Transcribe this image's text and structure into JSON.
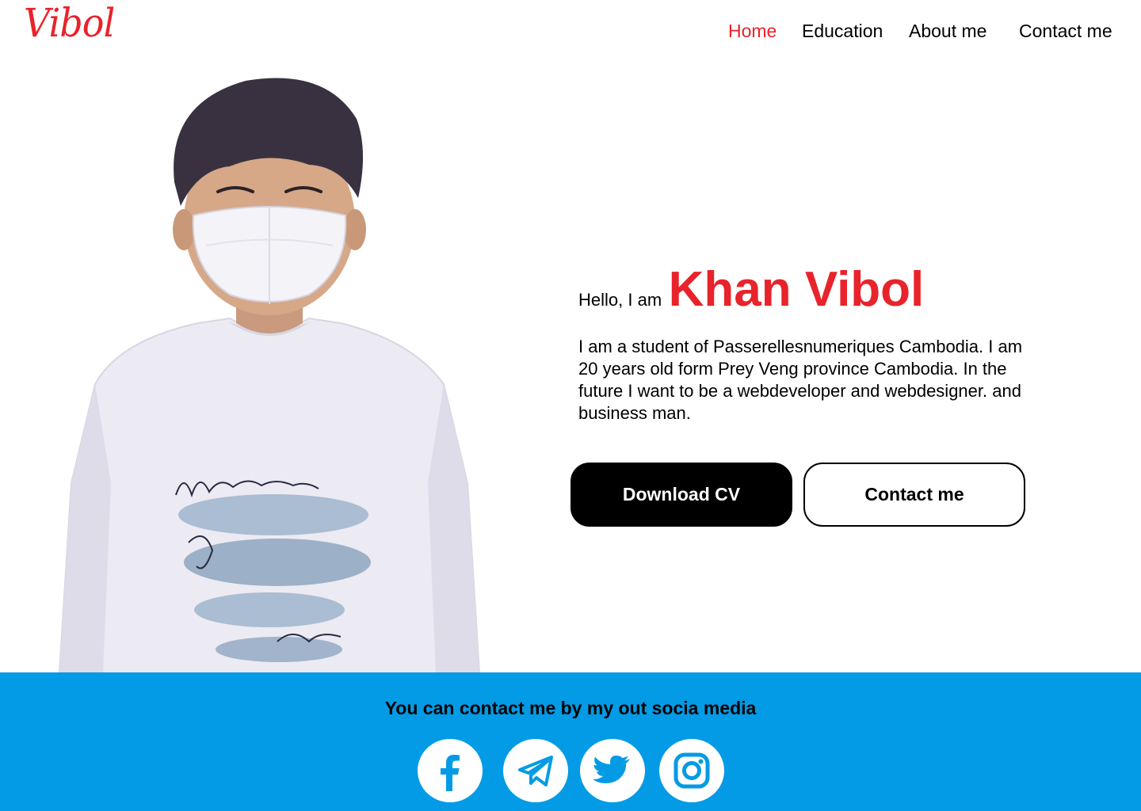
{
  "header": {
    "logo": "Vibol",
    "nav": [
      {
        "label": "Home",
        "active": true
      },
      {
        "label": "Education",
        "active": false
      },
      {
        "label": "About me",
        "active": false
      },
      {
        "label": "Contact me",
        "active": false
      }
    ]
  },
  "hero": {
    "greeting": "Hello, I am",
    "name": "Khan Vibol",
    "bio": "I am a student of Passerellesnumeriques Cambodia. I am 20 years old  form Prey Veng province Cambodia. In the future I want to be a webdeveloper and webdesigner. and business man.",
    "buttons": {
      "download": "Download CV",
      "contact": "Contact me"
    },
    "photo_icon": "portrait-photo"
  },
  "footer": {
    "text": "You can contact me by my out socia media",
    "social": [
      {
        "icon": "facebook-icon"
      },
      {
        "icon": "telegram-icon"
      },
      {
        "icon": "twitter-icon"
      },
      {
        "icon": "instagram-icon"
      }
    ]
  },
  "colors": {
    "accent": "#e8232b",
    "footer_bg": "#039be5",
    "button_dark": "#000000",
    "text": "#000000"
  }
}
